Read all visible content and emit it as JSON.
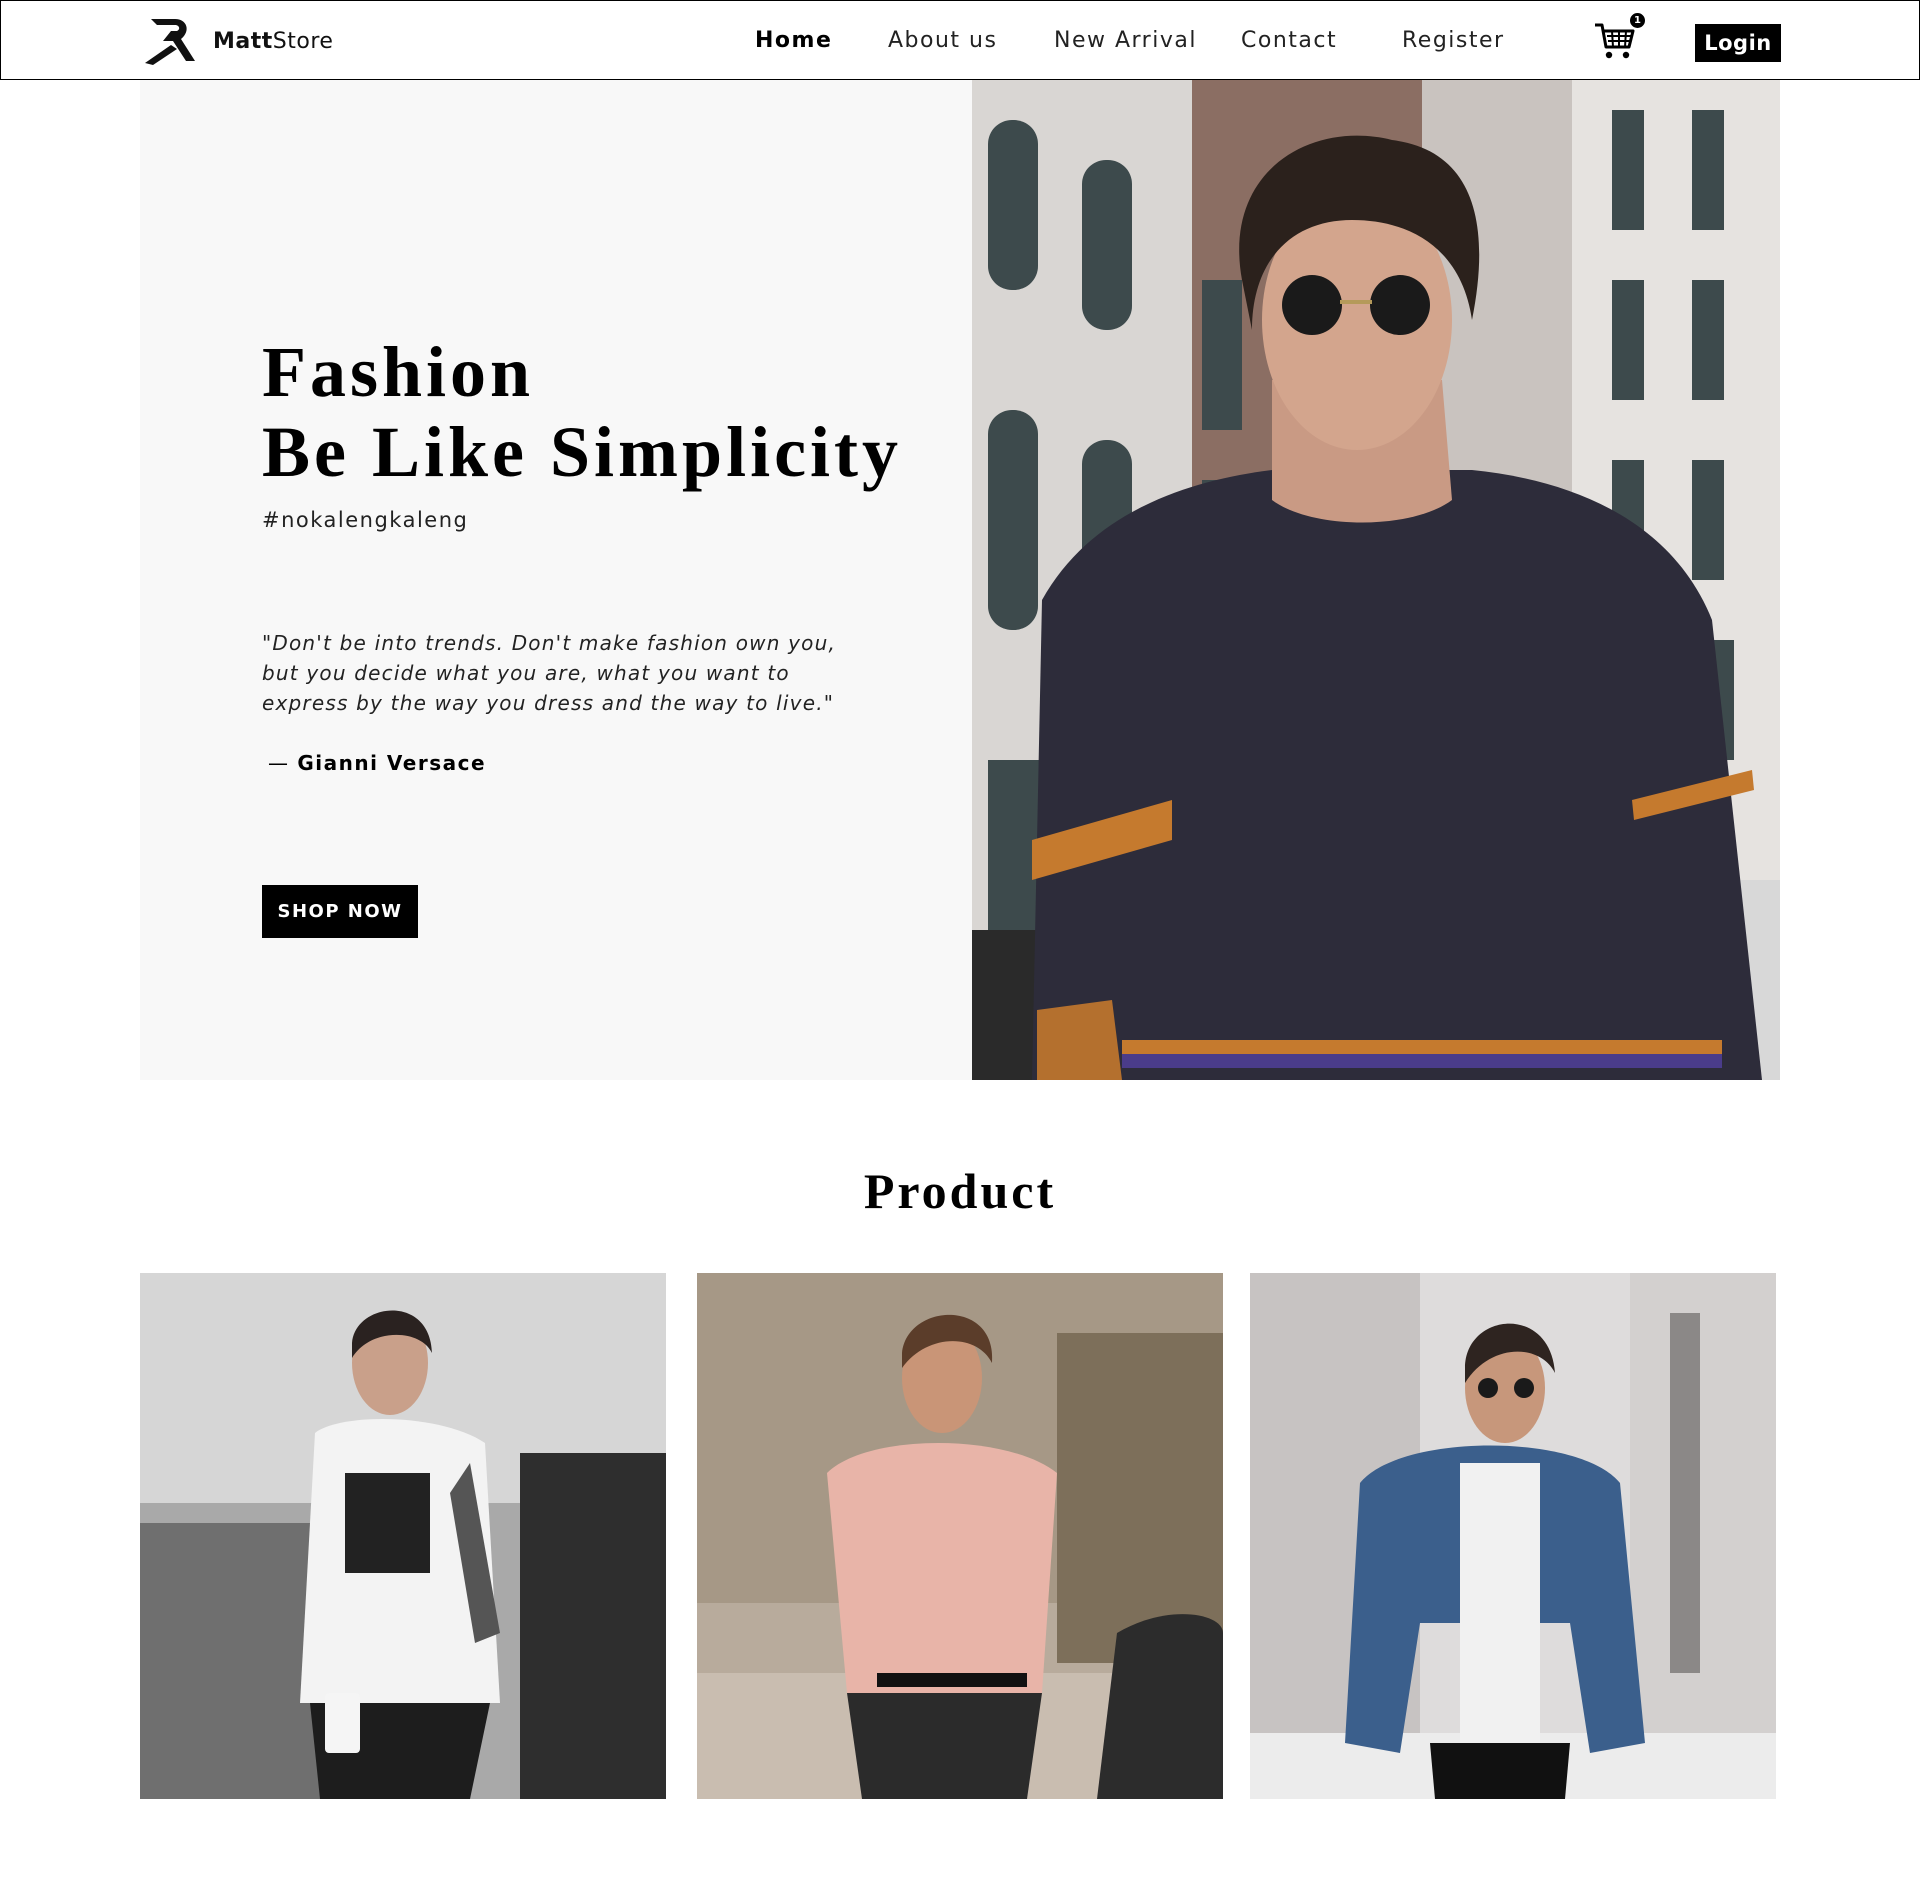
{
  "brand": {
    "name_bold": "Matt",
    "name_regular": "Store"
  },
  "nav": {
    "links": [
      {
        "label": "Home",
        "active": true
      },
      {
        "label": "About us",
        "active": false
      },
      {
        "label": "New Arrival",
        "active": false
      },
      {
        "label": "Contact",
        "active": false
      },
      {
        "label": "Register",
        "active": false
      }
    ],
    "cart_count": "1",
    "login_label": "Login"
  },
  "hero": {
    "title_line1": "Fashion",
    "title_line2": "Be Like Simplicity",
    "hashtag": "#nokalengkaleng",
    "quote_lines": [
      "\"Don't be into trends. Don't make fashion own you,",
      "but you decide what you are, what you want to",
      "express by the way you dress and the way to live.\""
    ],
    "author_dash": "—",
    "author_name": "Gianni Versace",
    "cta_label": "SHOP NOW"
  },
  "products": {
    "title": "Product",
    "items": [
      {
        "name": "product-white-tshirt"
      },
      {
        "name": "product-pink-shirt"
      },
      {
        "name": "product-denim-jacket"
      }
    ]
  },
  "colors": {
    "accent": "#000000",
    "hero_bg": "#f8f8f8",
    "text": "#222222"
  }
}
